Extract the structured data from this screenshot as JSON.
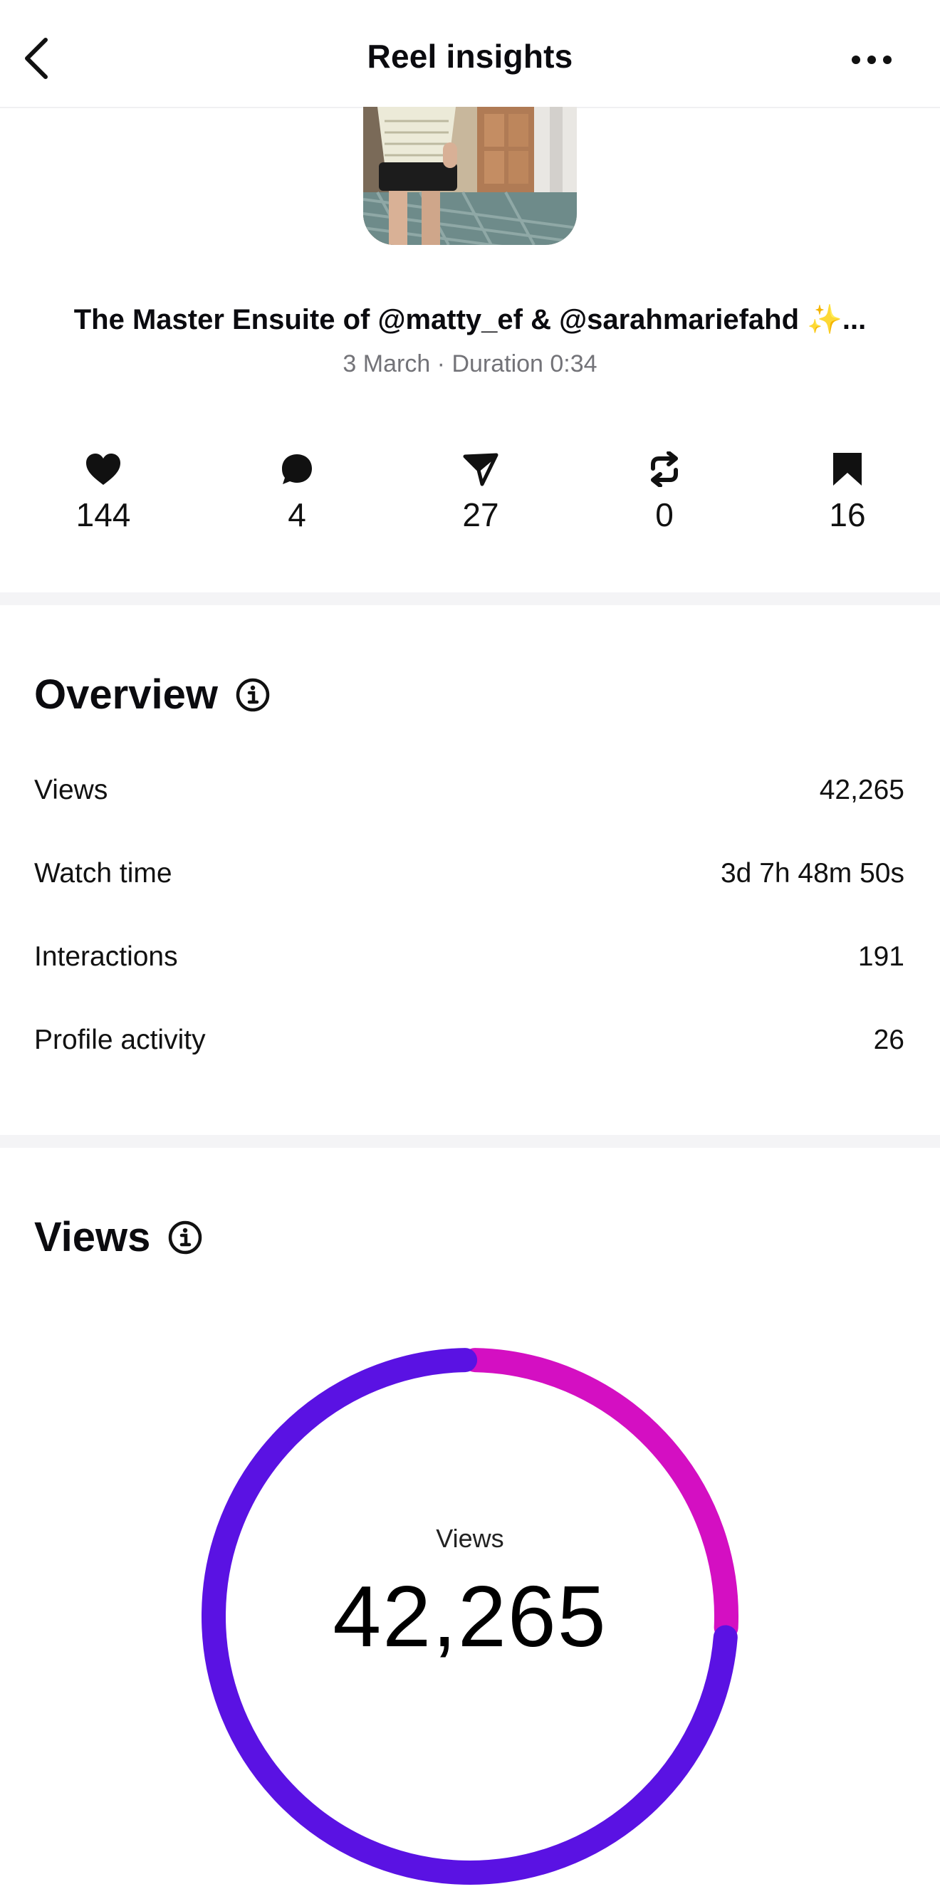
{
  "header": {
    "title": "Reel insights"
  },
  "reel": {
    "caption": "The Master Ensuite of @matty_ef & @sarahmariefahd ✨...",
    "meta": "3 March · Duration 0:34"
  },
  "stats": {
    "likes": "144",
    "comments": "4",
    "shares": "27",
    "reposts": "0",
    "saves": "16"
  },
  "overview": {
    "title": "Overview",
    "rows": [
      {
        "label": "Views",
        "value": "42,265"
      },
      {
        "label": "Watch time",
        "value": "3d 7h 48m 50s"
      },
      {
        "label": "Interactions",
        "value": "191"
      },
      {
        "label": "Profile activity",
        "value": "26"
      }
    ]
  },
  "views": {
    "title": "Views",
    "donut_label": "Views",
    "donut_value": "42,265"
  },
  "chart_data": {
    "type": "pie",
    "segments": [
      {
        "share": 0.26,
        "color": "#d40fc2"
      },
      {
        "share": 0.74,
        "color": "#5a12e3"
      }
    ]
  }
}
